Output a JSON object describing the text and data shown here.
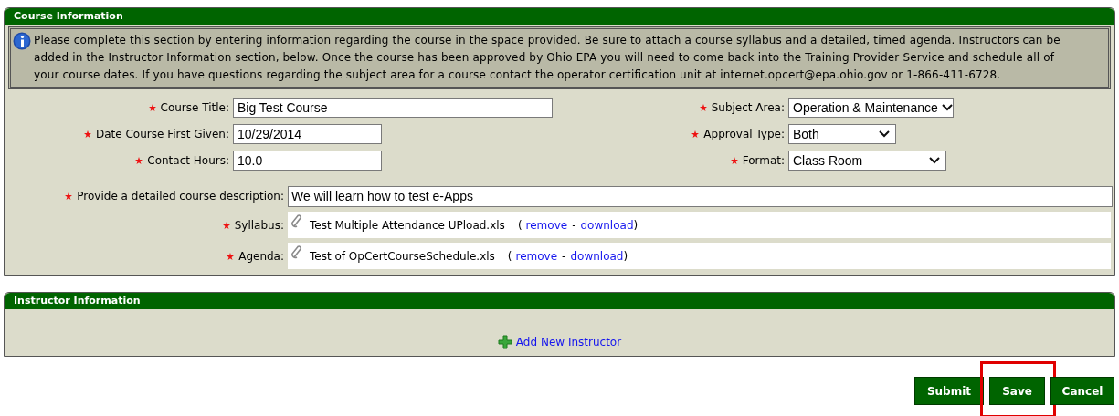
{
  "course_information": {
    "title": "Course Information",
    "info_text": "Please complete this section by entering information regarding the course in the space provided. Be sure to attach a course syllabus and a detailed, timed agenda. Instructors can be added in the Instructor Information section, below. Once the course has been approved by Ohio EPA you will need to come back into the Training Provider Service and schedule all of your course dates. If you have questions regarding the subject area for a course contact the operator certification unit at internet.opcert@epa.ohio.gov or 1-866-411-6728.",
    "fields_left": [
      {
        "kind": "text",
        "label": "Course Title:",
        "required": true,
        "value": "Big Test Course"
      },
      {
        "kind": "text",
        "label": "Date Course First Given:",
        "required": true,
        "value": "10/29/2014"
      },
      {
        "kind": "text",
        "label": "Contact Hours:",
        "required": true,
        "value": "10.0"
      }
    ],
    "fields_right": [
      {
        "kind": "select",
        "label": "Subject Area:",
        "required": true,
        "value": "Operation & Maintenance"
      },
      {
        "kind": "select",
        "label": "Approval Type:",
        "required": true,
        "value": "Both"
      },
      {
        "kind": "select",
        "label": "Format:",
        "required": true,
        "value": "Class Room"
      }
    ],
    "description": {
      "label": "Provide a detailed course description:",
      "required": true,
      "value": "We will learn how to test e-Apps"
    },
    "attachments": [
      {
        "label": "Syllabus:",
        "required": true,
        "file": "Test Multiple Attendance UPload.xls",
        "open": "(",
        "links": [
          "remove",
          "download"
        ],
        "separator": "-",
        "close": ")"
      },
      {
        "label": "Agenda:",
        "required": true,
        "file": "Test of OpCertCourseSchedule.xls",
        "open": "(",
        "links": [
          "remove",
          "download"
        ],
        "separator": "-",
        "close": ")"
      }
    ]
  },
  "instructor_information": {
    "title": "Instructor Information",
    "add_link": "Add New Instructor"
  },
  "buttons": [
    {
      "label": "Submit",
      "highlighted": false
    },
    {
      "label": "Save",
      "highlighted": true
    },
    {
      "label": "Cancel",
      "highlighted": false
    }
  ]
}
